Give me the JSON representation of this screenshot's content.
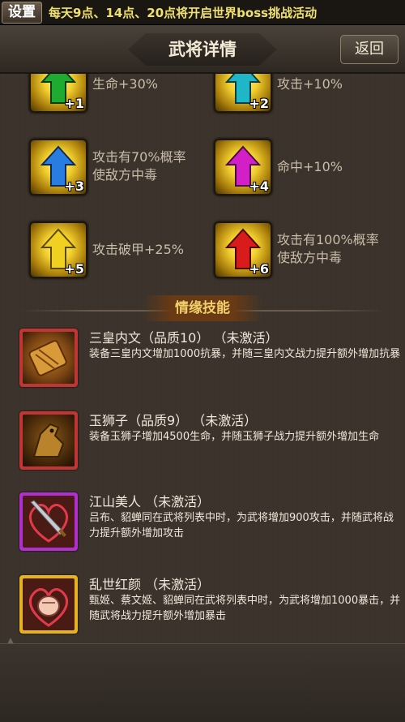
{
  "topbar": {
    "settings_label": "设置",
    "marquee": "每天9点、14点、20点将开启世界boss挑战活动"
  },
  "header": {
    "title": "武将详情",
    "back_label": "返回"
  },
  "stars": [
    {
      "level": "+1",
      "text": "生命+30%",
      "color": "#1faa32",
      "icon": "green-arrow-up-icon"
    },
    {
      "level": "+2",
      "text": "攻击+10%",
      "color": "#1fb6c8",
      "icon": "cyan-arrow-up-icon"
    },
    {
      "level": "+3",
      "text": "攻击有70%概率使敌方中毒",
      "color": "#2a7de0",
      "icon": "blue-arrow-up-icon"
    },
    {
      "level": "+4",
      "text": "命中+10%",
      "color": "#d21fc6",
      "icon": "magenta-arrow-up-icon"
    },
    {
      "level": "+5",
      "text": "攻击破甲+25%",
      "color": "#e9c420",
      "icon": "yellow-arrow-up-icon"
    },
    {
      "level": "+6",
      "text": "攻击有100%概率使敌方中毒",
      "color": "#d81c1c",
      "icon": "red-arrow-up-icon"
    }
  ],
  "section": {
    "title": "情缘技能"
  },
  "skills": [
    {
      "name": "三皇内文（品质10）  （未激活）",
      "desc": "装备三皇内文增加1000抗暴，并随三皇内文战力提升额外增加抗暴",
      "frame": "#c23535",
      "icon": "scroll-icon"
    },
    {
      "name": "玉狮子（品质9）  （未激活）",
      "desc": "装备玉狮子增加4500生命，并随玉狮子战力提升额外增加生命",
      "frame": "#c23535",
      "icon": "horse-icon"
    },
    {
      "name": "江山美人  （未激活）",
      "desc": "吕布、貂蝉同在武将列表中时，为武将增加900攻击，并随武将战力提升额外增加攻击",
      "frame": "#b12fd0",
      "icon": "sword-heart-icon"
    },
    {
      "name": "乱世红颜  （未激活）",
      "desc": "甄姬、蔡文姬、貂蝉同在武将列表中时，为武将增加1000暴击，并随武将战力提升额外增加暴击",
      "frame": "#e6b31e",
      "icon": "fist-heart-icon"
    }
  ]
}
